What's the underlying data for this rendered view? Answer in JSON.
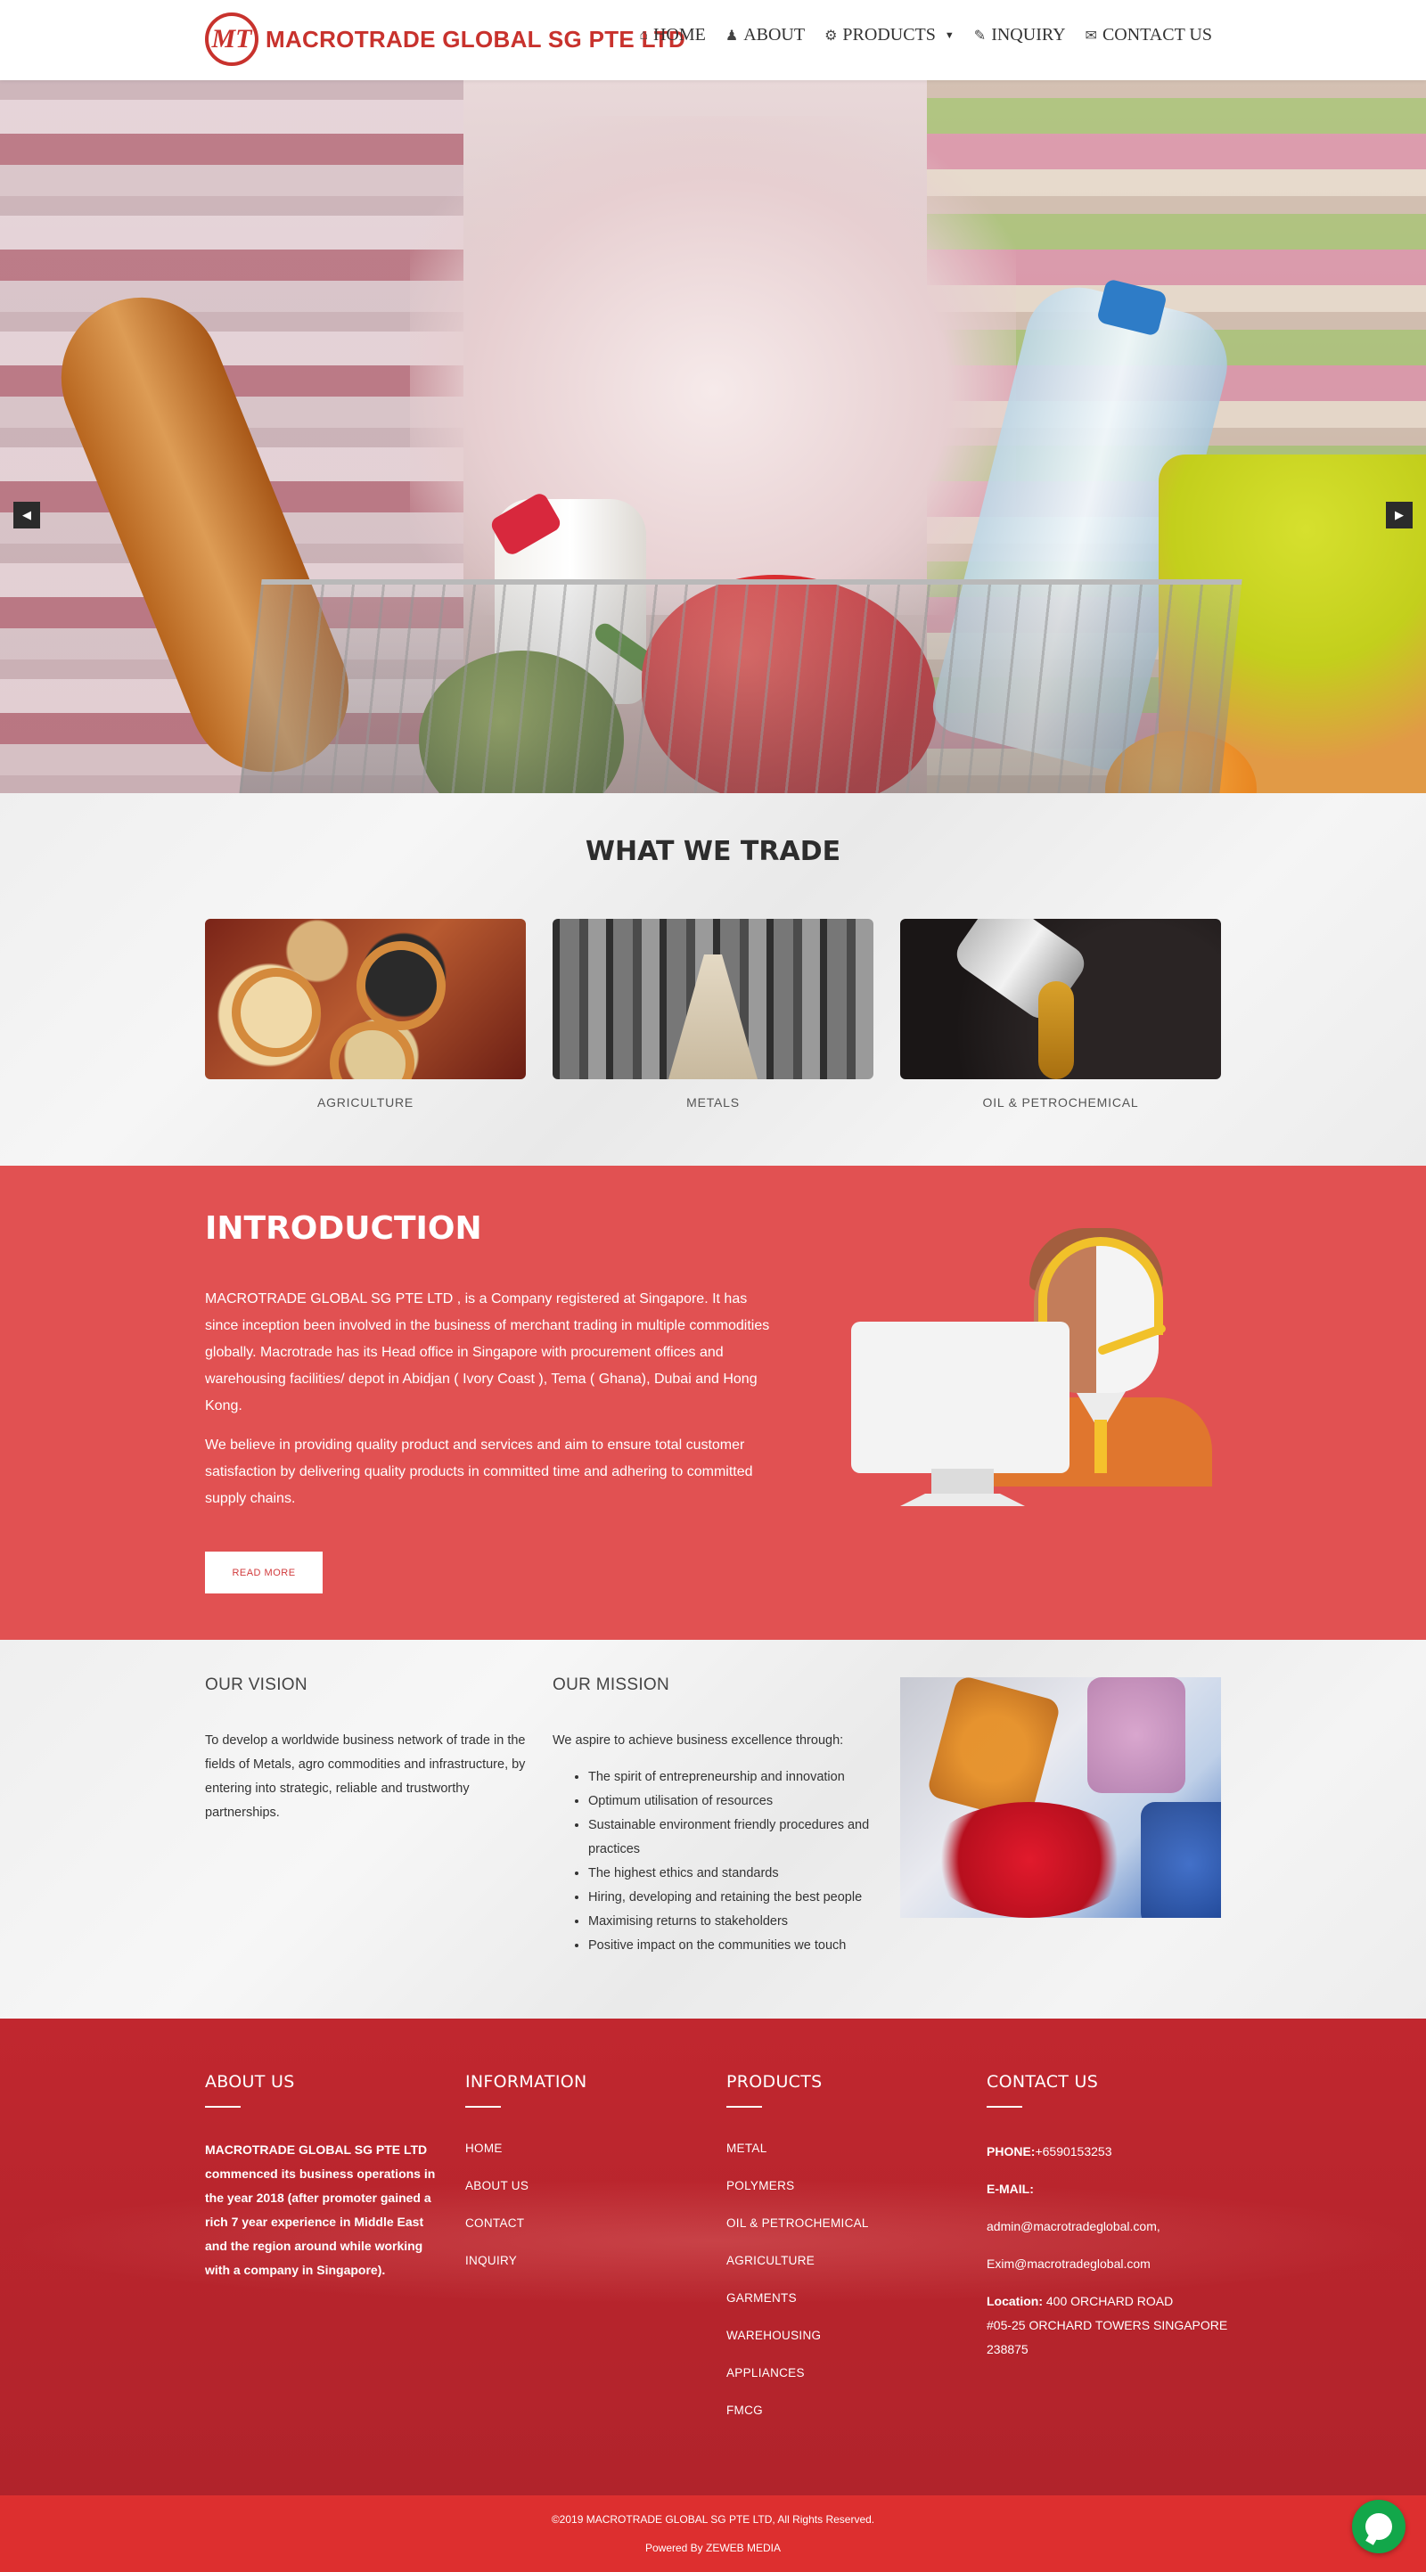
{
  "header": {
    "logo_mark": "MT",
    "logo_text": "MACROTRADE GLOBAL SG PTE LTD",
    "nav": [
      {
        "label": "HOME",
        "icon": "home-icon",
        "glyph": "⌂"
      },
      {
        "label": "ABOUT",
        "icon": "user-icon",
        "glyph": "♟"
      },
      {
        "label": "PRODUCTS",
        "icon": "gear-icon",
        "glyph": "⚙",
        "caret": "▼"
      },
      {
        "label": "INQUIRY",
        "icon": "edit-icon",
        "glyph": "✎"
      },
      {
        "label": "CONTACT US",
        "icon": "envelope-icon",
        "glyph": "✉"
      }
    ]
  },
  "hero": {
    "prev_glyph": "◀",
    "next_glyph": "▶"
  },
  "trade": {
    "title": "WHAT WE TRADE",
    "items": [
      {
        "label": "AGRICULTURE"
      },
      {
        "label": "METALS"
      },
      {
        "label": "OIL & PETROCHEMICAL"
      }
    ]
  },
  "intro": {
    "title": "INTRODUCTION",
    "paragraph1": "MACROTRADE GLOBAL SG PTE LTD , is a Company registered at Singapore. It has since inception been involved in the business of merchant trading in multiple commodities globally. Macrotrade has its Head office in Singapore with procurement offices and warehousing facilities/ depot in Abidjan ( Ivory Coast ), Tema ( Ghana), Dubai and Hong Kong.",
    "paragraph2": "We believe in providing quality product and services and aim to ensure total customer satisfaction by delivering quality products in committed time and adhering to committed supply chains.",
    "button": "READ MORE"
  },
  "vision": {
    "title": "OUR VISION",
    "text": "To develop a worldwide business network of trade in the fields of Metals, agro commodities and infrastructure, by entering into strategic, reliable and trustworthy partnerships."
  },
  "mission": {
    "title": "OUR MISSION",
    "intro": "We aspire to achieve business excellence through:",
    "items": [
      "The spirit of entrepreneurship and innovation",
      "Optimum utilisation of resources",
      "Sustainable environment friendly procedures and practices",
      "The highest ethics and standards",
      "Hiring, developing and retaining the best people",
      "Maximising returns to stakeholders",
      "Positive impact on the communities we touch"
    ]
  },
  "footer": {
    "about_title": "ABOUT US",
    "about_text": "MACROTRADE GLOBAL SG PTE LTD commenced its business operations in the year 2018 (after promoter gained a rich 7 year experience in Middle East and the region around while working with a company in Singapore).",
    "info_title": "INFORMATION",
    "info_links": [
      "HOME",
      "ABOUT US",
      "CONTACT",
      "INQUIRY"
    ],
    "products_title": "PRODUCTS",
    "product_links": [
      "METAL",
      "POLYMERS",
      "OIL & PETROCHEMICAL",
      "AGRICULTURE",
      "GARMENTS",
      "WAREHOUSING",
      "APPLIANCES",
      "FMCG"
    ],
    "contact_title": "CONTACT US",
    "phone_label": "PHONE:",
    "phone": "+6590153253",
    "email_label": "E-MAIL:",
    "email1": "admin@macrotradeglobal.com,",
    "email2": "Exim@macrotradeglobal.com",
    "location_label": "Location:",
    "location_line1": "400 ORCHARD ROAD",
    "location_line2": "#05-25 ORCHARD TOWERS SINGAPORE 238875"
  },
  "bottom": {
    "copyright": "©2019 MACROTRADE GLOBAL SG PTE LTD, All Rights Reserved.",
    "powered": "Powered By ZEWEB MEDIA"
  },
  "colors": {
    "brand_red": "#c8322d",
    "intro_red": "#e15152",
    "footer_red": "#b9252d",
    "bottom_red": "#dd2f2f",
    "chat_green": "#12a74a"
  }
}
